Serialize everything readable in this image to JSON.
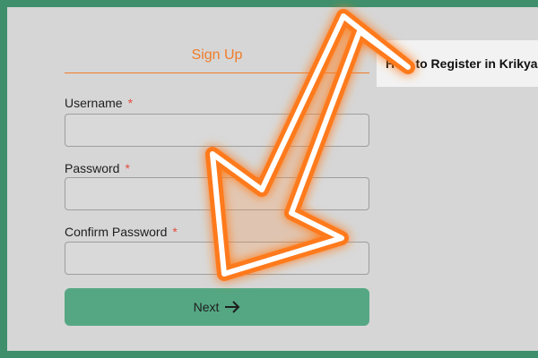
{
  "signup": {
    "tab_label": "Sign Up",
    "fields": {
      "username": {
        "label": "Username",
        "required_mark": "*",
        "value": ""
      },
      "password": {
        "label": "Password",
        "required_mark": "*",
        "value": ""
      },
      "confirm_password": {
        "label": "Confirm Password",
        "required_mark": "*",
        "value": ""
      }
    },
    "next_button_label": "Next"
  },
  "help": {
    "title": "How to Register in Krikya"
  },
  "icons": {
    "next_arrow": "arrow-right-icon",
    "pointer_arrow": "glowing-arrow-icon"
  },
  "colors": {
    "accent": "#f07c2a",
    "frame_border": "#3f8f6c",
    "next_button": "#55a783",
    "required": "#e24e3d"
  }
}
